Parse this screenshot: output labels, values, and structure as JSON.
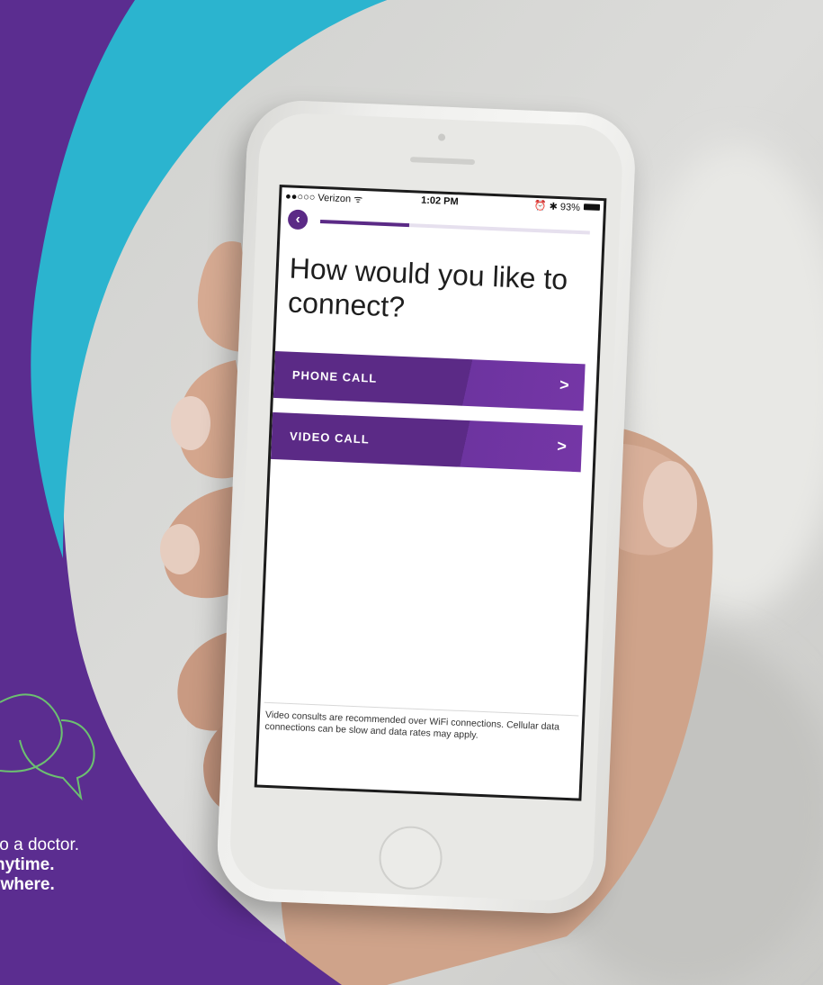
{
  "status_bar": {
    "carrier": "●●○○○ Verizon ᯤ",
    "time": "1:02 PM",
    "battery": "⏰ ✱ 93%"
  },
  "screen": {
    "back_icon": "chevron-left-icon",
    "progress_value": 0.33,
    "title": "How would you like to connect?",
    "options": [
      {
        "label": "PHONE CALL",
        "icon": "chevron-right-icon"
      },
      {
        "label": "VIDEO CALL",
        "icon": "chevron-right-icon"
      }
    ],
    "footer_note": "Video consults are recommended over WiFi connections. Cellular data connections can be slow and data rates may apply."
  },
  "tagline": {
    "line1": "to a doctor.",
    "line2": "nytime.",
    "line3": "ywhere."
  },
  "colors": {
    "brand_purple": "#5b2a86",
    "cyan": "#2bb4cf",
    "icon_green": "#6cc070"
  }
}
